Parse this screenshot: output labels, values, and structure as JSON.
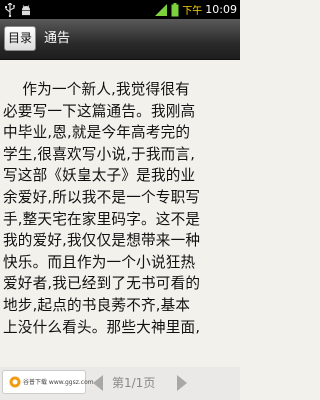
{
  "statusbar": {
    "ampm": "下午",
    "time": "10:09"
  },
  "titlebar": {
    "toc_button_label": "目录",
    "chapter_title": "通告"
  },
  "content": {
    "lines": [
      "    作为一个新人,我觉得很有",
      "必要写一下这篇通告。我刚高",
      "中毕业,恩,就是今年高考完的",
      "学生,很喜欢写小说,于我而言,",
      "写这部《妖皇太子》是我的业",
      "余爱好,所以我不是一个专职写",
      "手,整天宅在家里码字。这不是",
      "我的爱好,我仅仅是想带来一种",
      "快乐。而且作为一个小说狂热",
      "爱好者,我已经到了无书可看的",
      "地步,起点的书良莠不齐,基本",
      "上没什么看头。那些大神里面,"
    ]
  },
  "bottombar": {
    "ad_text": "谷普下载 www.ggsz.com",
    "page_indicator": "第1/1页"
  }
}
